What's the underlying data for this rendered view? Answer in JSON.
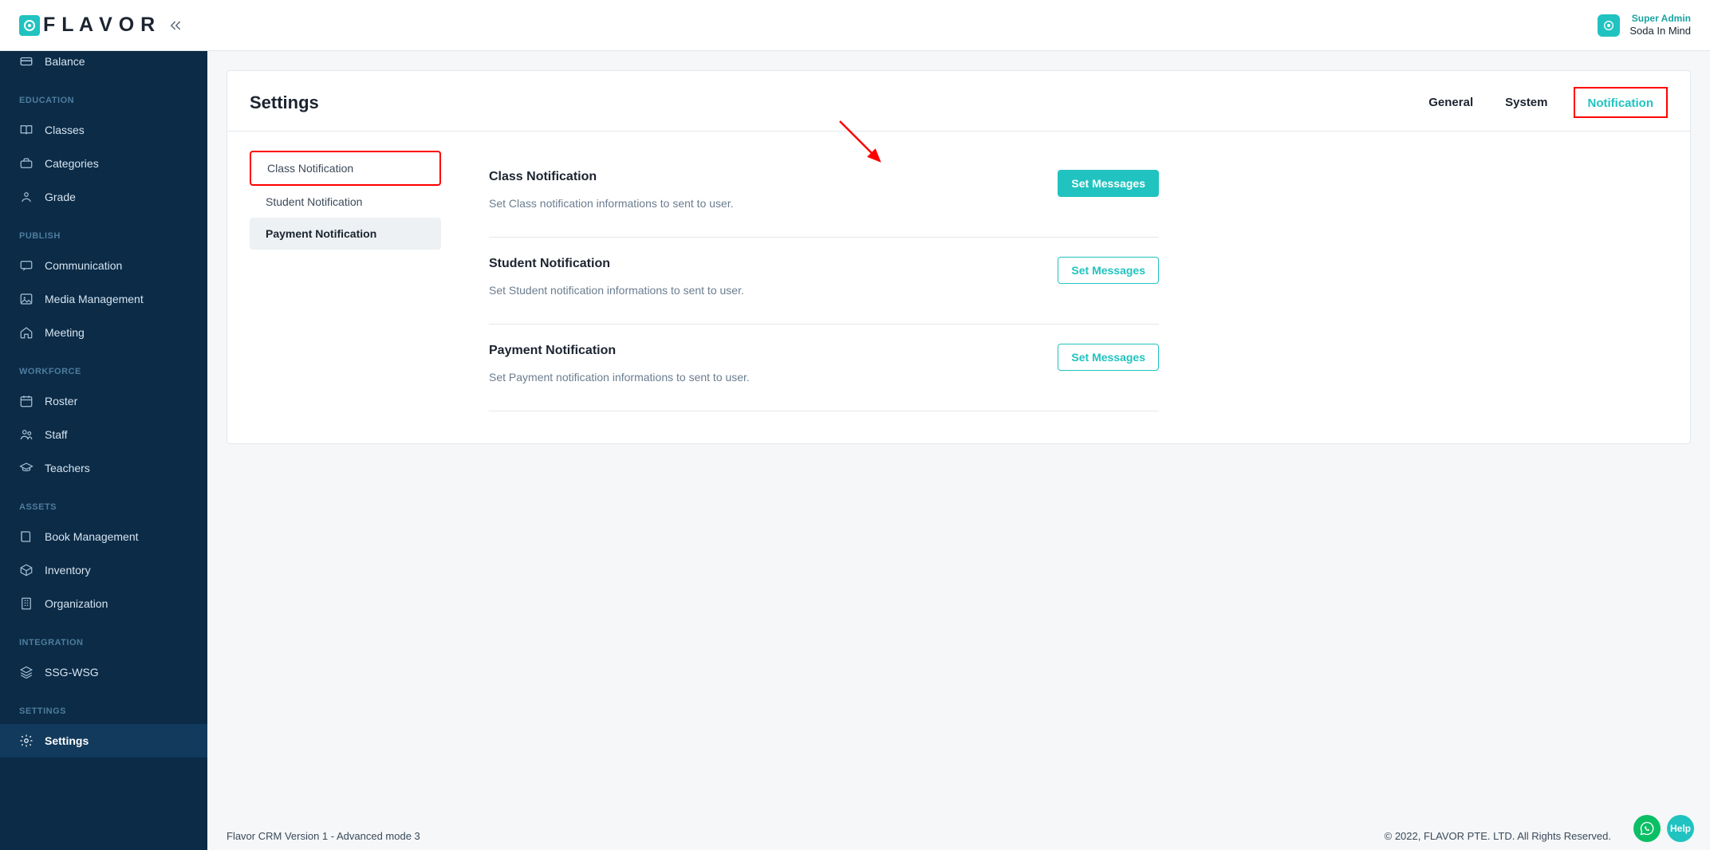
{
  "header": {
    "brand": "F L A V O R",
    "user_role": "Super Admin",
    "user_name": "Soda In Mind"
  },
  "sidebar": {
    "balance_label": "Balance",
    "sections": [
      {
        "title": "EDUCATION",
        "items": [
          {
            "label": "Classes",
            "icon": "book-open"
          },
          {
            "label": "Categories",
            "icon": "briefcase"
          },
          {
            "label": "Grade",
            "icon": "user-graduate"
          }
        ]
      },
      {
        "title": "PUBLISH",
        "items": [
          {
            "label": "Communication",
            "icon": "chat"
          },
          {
            "label": "Media Management",
            "icon": "image"
          },
          {
            "label": "Meeting",
            "icon": "home"
          }
        ]
      },
      {
        "title": "WORKFORCE",
        "items": [
          {
            "label": "Roster",
            "icon": "calendar"
          },
          {
            "label": "Staff",
            "icon": "people"
          },
          {
            "label": "Teachers",
            "icon": "grad-cap"
          }
        ]
      },
      {
        "title": "ASSETS",
        "items": [
          {
            "label": "Book Management",
            "icon": "book"
          },
          {
            "label": "Inventory",
            "icon": "box"
          },
          {
            "label": "Organization",
            "icon": "building"
          }
        ]
      },
      {
        "title": "INTEGRATION",
        "items": [
          {
            "label": "SSG-WSG",
            "icon": "layers"
          }
        ]
      },
      {
        "title": "SETTINGS",
        "items": [
          {
            "label": "Settings",
            "icon": "gear",
            "active": true
          }
        ]
      }
    ]
  },
  "page": {
    "title": "Settings",
    "tabs": [
      {
        "label": "General"
      },
      {
        "label": "System"
      },
      {
        "label": "Notification",
        "active": true,
        "highlight": true
      }
    ],
    "subnav": [
      {
        "label": "Class Notification",
        "highlight": true
      },
      {
        "label": "Student Notification"
      },
      {
        "label": "Payment Notification",
        "selected": true
      }
    ],
    "sections": [
      {
        "title": "Class Notification",
        "desc": "Set Class notification informations to sent to user.",
        "button": "Set Messages",
        "button_style": "primary",
        "arrow": true
      },
      {
        "title": "Student Notification",
        "desc": "Set Student notification informations to sent to user.",
        "button": "Set Messages",
        "button_style": "outline"
      },
      {
        "title": "Payment Notification",
        "desc": "Set Payment notification informations to sent to user.",
        "button": "Set Messages",
        "button_style": "outline"
      }
    ]
  },
  "footer": {
    "left": "Flavor CRM Version 1 - Advanced mode 3",
    "right": "© 2022, FLAVOR PTE. LTD. All Rights Reserved.",
    "help_label": "Help"
  }
}
